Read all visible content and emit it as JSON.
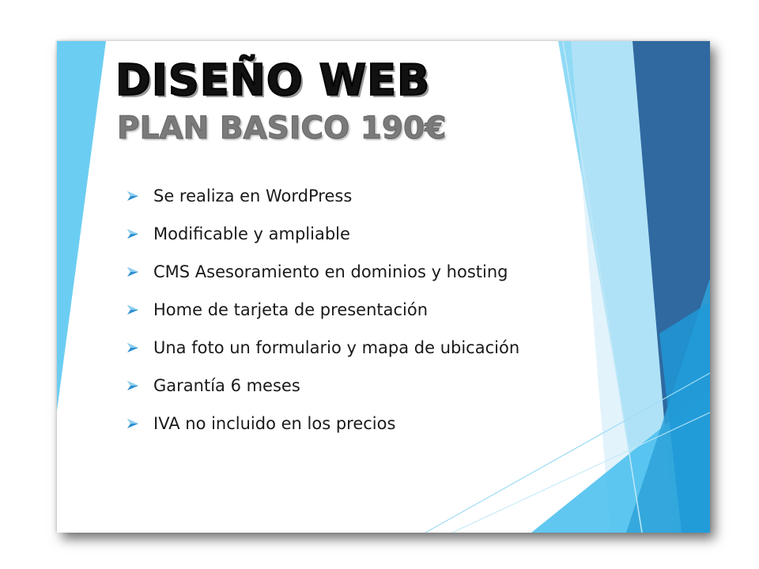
{
  "slide": {
    "title": "DISEÑO WEB",
    "subtitle": "PLAN BASICO 190€",
    "bullet_icon": "arrow-bullet-icon",
    "bullets": [
      "Se realiza en WordPress",
      "Modificable y ampliable",
      "CMS Asesoramiento en dominios y hosting",
      "Home de tarjeta de presentación",
      "Una foto un formulario y mapa de ubicación",
      "Garantía 6 meses",
      "IVA no incluido en los precios"
    ]
  },
  "colors": {
    "accent_light": "#6ccdf2",
    "accent_mid": "#2ea3d9",
    "accent_dark": "#2f69a0",
    "title": "#111111",
    "subtitle": "#7a7a7a"
  }
}
